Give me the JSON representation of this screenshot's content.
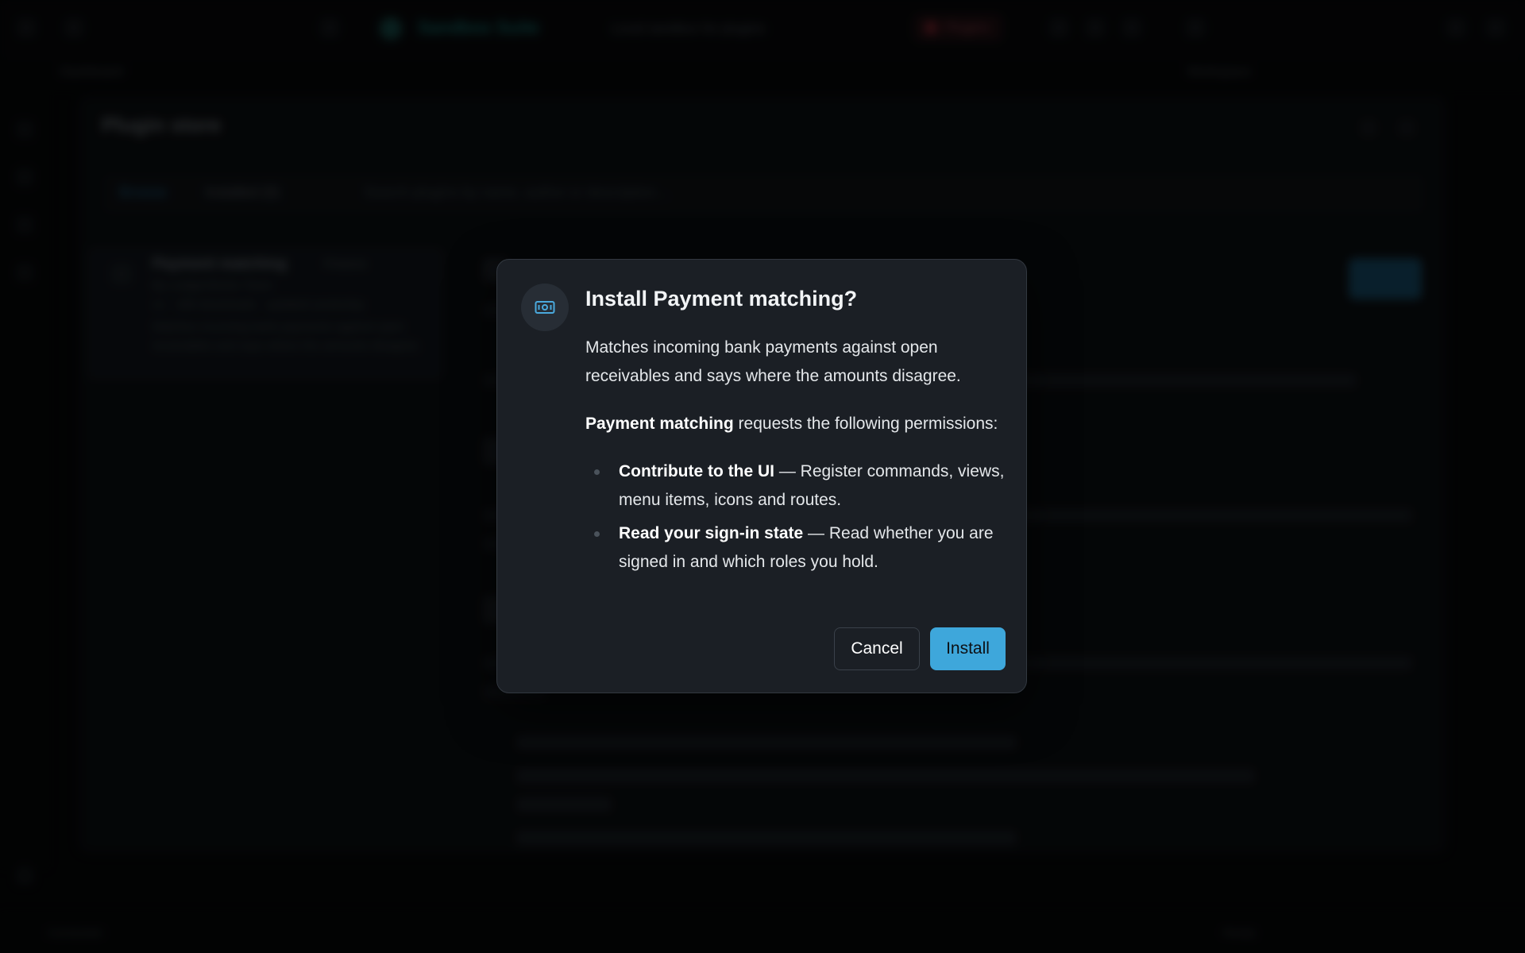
{
  "background": {
    "app_title": "Sandbox Suite",
    "app_subtitle": "Local sandbox for plugins",
    "plugins_button": "Plugins",
    "breadcrumb": "Dashboard",
    "right_crumb": "Workspace",
    "store": {
      "title": "Plugin store",
      "tabs": [
        "Browse",
        "Installed (0)"
      ],
      "search_placeholder": "Search plugins by name, author or description…",
      "card": {
        "name": "Payment matching",
        "badge": "Finance",
        "author": "By LedgerWorks Team",
        "meta": "v1 · 186 downloads · updated yesterday",
        "description": "Matches incoming bank payments against open receivables and says where the amounts disagree."
      },
      "detail_install_label": "Install"
    },
    "status_left": "Connected",
    "status_right": "Ready"
  },
  "dialog": {
    "icon": "banknote-icon",
    "title": "Install Payment matching?",
    "description": "Matches incoming bank payments against open receivables and says where the amounts disagree.",
    "plugin_name": "Payment matching",
    "permissions_intro": " requests the following permissions:",
    "permissions": [
      {
        "name": "Contribute to the UI",
        "detail": " — Register commands, views, menu items, icons and routes."
      },
      {
        "name": "Read your sign-in state",
        "detail": " — Read whether you are signed in and which roles you hold."
      }
    ],
    "cancel_label": "Cancel",
    "install_label": "Install"
  },
  "colors": {
    "accent": "#3ea7db",
    "dialog_bg": "#1b1f25",
    "page_bg": "#050607"
  }
}
